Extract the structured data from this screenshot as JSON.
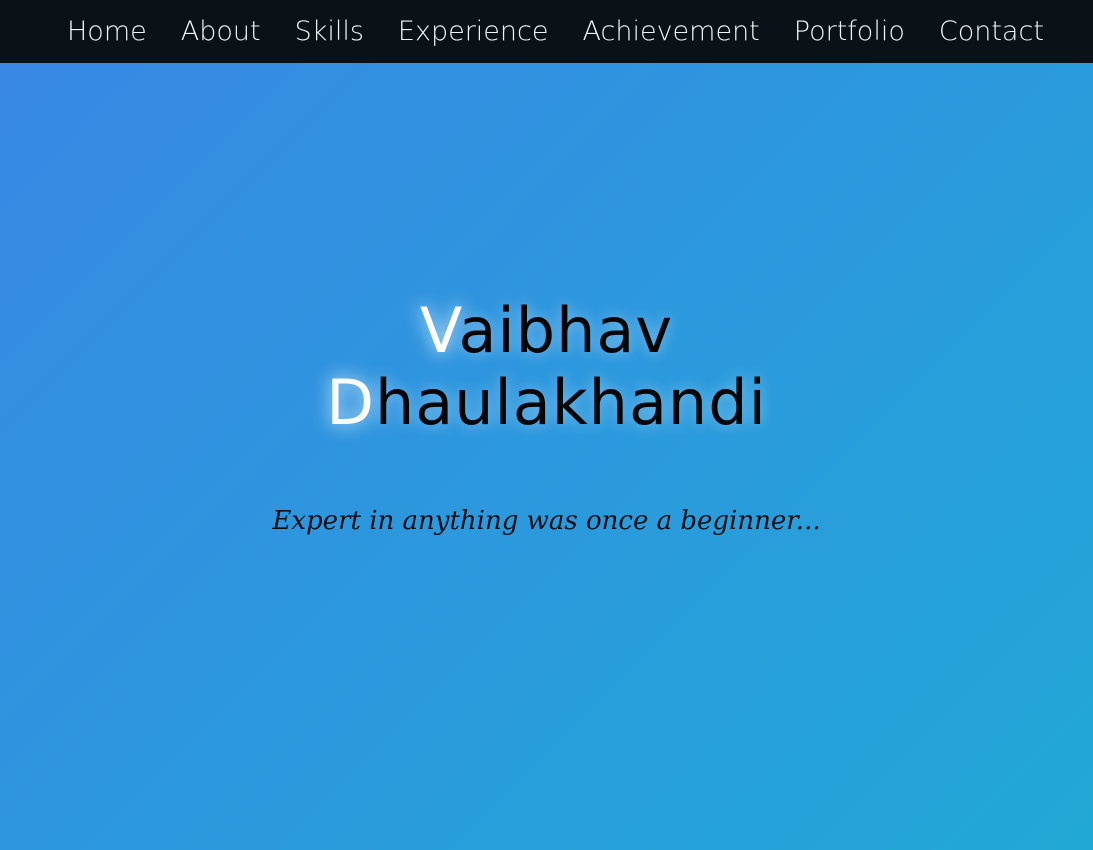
{
  "nav": {
    "items": [
      {
        "label": "Home"
      },
      {
        "label": "About"
      },
      {
        "label": "Skills"
      },
      {
        "label": "Experience"
      },
      {
        "label": "Achievement"
      },
      {
        "label": "Portfolio"
      },
      {
        "label": "Contact"
      }
    ]
  },
  "hero": {
    "first_name_initial": "V",
    "first_name_rest": "aibhav",
    "last_name_initial": "D",
    "last_name_rest": "haulakhandi",
    "tagline": "Expert in anything was once a beginner..."
  },
  "colors": {
    "navbar_background": "#0a1117",
    "nav_text": "#f2f6f8",
    "gradient_start": "#3888e4",
    "gradient_end": "#21a8d7",
    "name_text": "#050608",
    "initial_highlight": "#ffffff"
  }
}
